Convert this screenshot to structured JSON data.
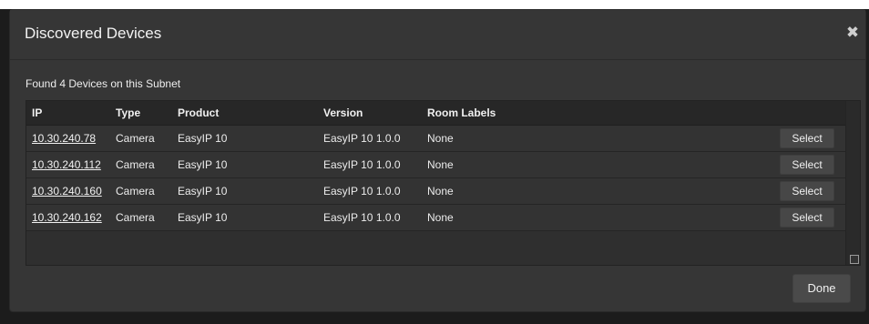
{
  "dialog": {
    "title": "Discovered Devices",
    "close_icon": "close-icon",
    "summary": "Found 4 Devices on this Subnet",
    "done_label": "Done"
  },
  "table": {
    "columns": [
      "IP",
      "Type",
      "Product",
      "Version",
      "Room Labels"
    ],
    "rows": [
      {
        "ip": "10.30.240.78",
        "type": "Camera",
        "product": "EasyIP 10",
        "version": "EasyIP 10 1.0.0",
        "room": "None",
        "action": "Select"
      },
      {
        "ip": "10.30.240.112",
        "type": "Camera",
        "product": "EasyIP 10",
        "version": "EasyIP 10 1.0.0",
        "room": "None",
        "action": "Select"
      },
      {
        "ip": "10.30.240.160",
        "type": "Camera",
        "product": "EasyIP 10",
        "version": "EasyIP 10 1.0.0",
        "room": "None",
        "action": "Select"
      },
      {
        "ip": "10.30.240.162",
        "type": "Camera",
        "product": "EasyIP 10",
        "version": "EasyIP 10 1.0.0",
        "room": "None",
        "action": "Select"
      }
    ]
  }
}
